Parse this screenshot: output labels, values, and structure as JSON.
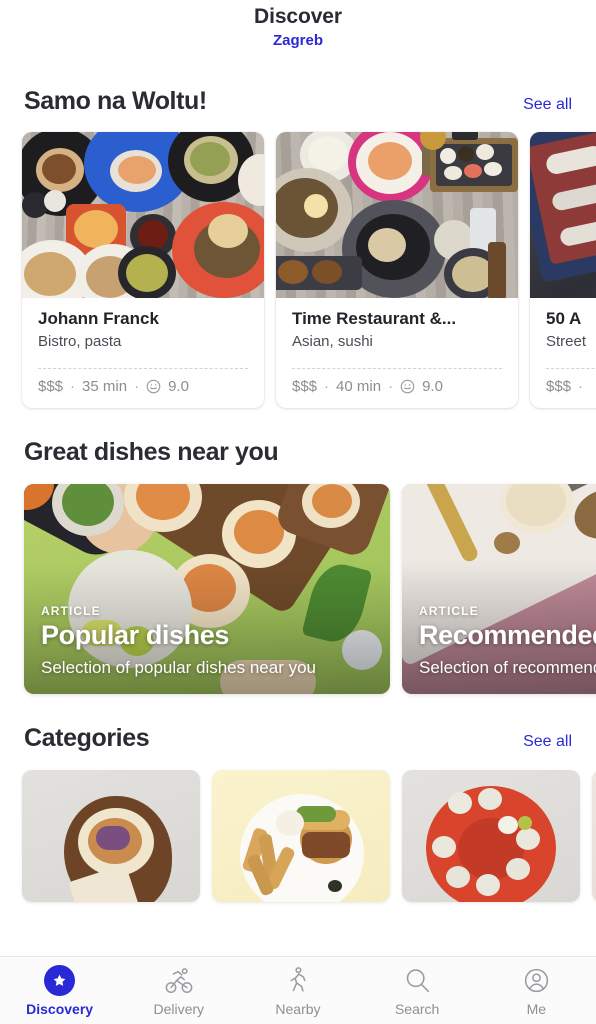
{
  "header": {
    "title": "Discover",
    "city": "Zagreb"
  },
  "sections": [
    {
      "title": "Samo na Woltu!",
      "see_all": "See all"
    },
    {
      "title": "Great dishes near you",
      "see_all": ""
    },
    {
      "title": "Categories",
      "see_all": "See all"
    }
  ],
  "venues": [
    {
      "name": "Johann Franck",
      "tags": "Bistro, pasta",
      "price": "$$$",
      "time": "35 min",
      "rating": "9.0"
    },
    {
      "name": "Time Restaurant &...",
      "tags": "Asian, sushi",
      "price": "$$$",
      "time": "40 min",
      "rating": "9.0"
    },
    {
      "name": "50 A",
      "tags": "Street",
      "price": "$$$",
      "time": "",
      "rating": ""
    }
  ],
  "articles": [
    {
      "kicker": "ARTICLE",
      "title": "Popular dishes",
      "desc": "Selection of popular dishes near you"
    },
    {
      "kicker": "ARTICLE",
      "title": "Recommended",
      "desc": "Selection of recommended dishes near you"
    }
  ],
  "categories": [
    {
      "name": "tacos"
    },
    {
      "name": "burger-and-fries"
    },
    {
      "name": "sushi-platter"
    },
    {
      "name": "partial"
    }
  ],
  "tabs": [
    {
      "label": "Discovery",
      "icon": "star-icon",
      "active": true
    },
    {
      "label": "Delivery",
      "icon": "cyclist-icon",
      "active": false
    },
    {
      "label": "Nearby",
      "icon": "walking-person-icon",
      "active": false
    },
    {
      "label": "Search",
      "icon": "search-icon",
      "active": false
    },
    {
      "label": "Me",
      "icon": "user-circle-icon",
      "active": false
    }
  ],
  "colors": {
    "accent": "#2929d6",
    "title": "#2b2b33",
    "muted": "#8c8c94"
  },
  "separators": {
    "dot": "·"
  }
}
